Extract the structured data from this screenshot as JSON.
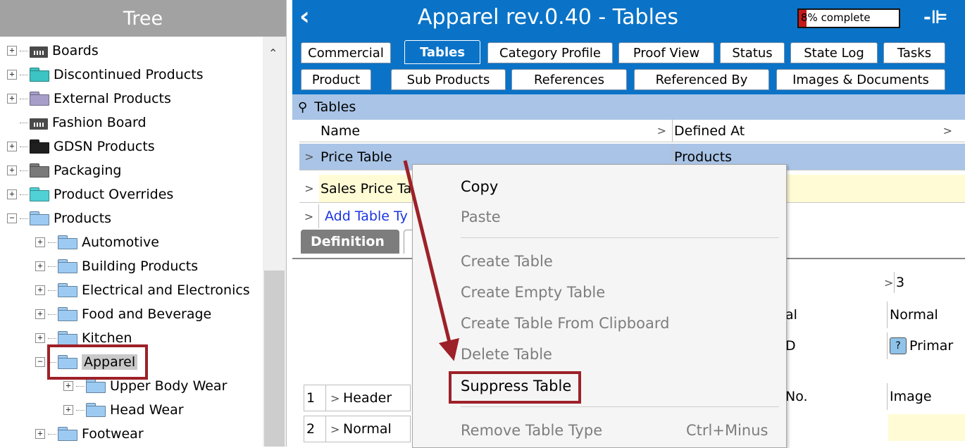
{
  "tree": {
    "title": "Tree",
    "items": [
      {
        "label": "Boards",
        "icon": "board-icon",
        "expander": "+"
      },
      {
        "label": "Discontinued Products",
        "icon": "folder-icon",
        "color": "#3cc3c3",
        "expander": "+"
      },
      {
        "label": "External Products",
        "icon": "folder-icon",
        "color": "#a79fc9",
        "expander": "+"
      },
      {
        "label": "Fashion Board",
        "icon": "board-icon",
        "expander": ""
      },
      {
        "label": "GDSN Products",
        "icon": "folder-icon",
        "color": "#1f1f1f",
        "expander": "+"
      },
      {
        "label": "Packaging",
        "icon": "folder-icon",
        "color": "#7a7a7a",
        "expander": "+"
      },
      {
        "label": "Product Overrides",
        "icon": "folder-icon",
        "color": "#4fd1d6",
        "expander": "+"
      },
      {
        "label": "Products",
        "icon": "folder-icon",
        "color": "#9ccaf2",
        "expander": "−"
      },
      {
        "label": "Automotive",
        "icon": "folder-icon",
        "color": "#9ccaf2",
        "expander": "+"
      },
      {
        "label": "Building Products",
        "icon": "folder-icon",
        "color": "#9ccaf2",
        "expander": "+"
      },
      {
        "label": "Electrical and Electronics",
        "icon": "folder-icon",
        "color": "#9ccaf2",
        "expander": "+"
      },
      {
        "label": "Food and Beverage",
        "icon": "folder-icon",
        "color": "#9ccaf2",
        "expander": "+"
      },
      {
        "label": "Kitchen",
        "icon": "folder-icon",
        "color": "#9ccaf2",
        "expander": "+"
      },
      {
        "label": "Apparel",
        "icon": "folder-icon",
        "color": "#9ccaf2",
        "expander": "−"
      },
      {
        "label": "Upper Body Wear",
        "icon": "folder-icon",
        "color": "#9ccaf2",
        "expander": "+"
      },
      {
        "label": "Head Wear",
        "icon": "folder-icon",
        "color": "#9ccaf2",
        "expander": "+"
      },
      {
        "label": "Footwear",
        "icon": "folder-icon",
        "color": "#9ccaf2",
        "expander": "+"
      }
    ]
  },
  "window": {
    "back_icon": "chevron-left-icon",
    "title": "Apparel rev.0.40 - Tables",
    "progress_text": "8% complete",
    "progress_fraction": 0.08,
    "pin_icon": "pin-icon"
  },
  "tabs": {
    "row1": [
      "Commercial",
      "Tables",
      "Category Profile",
      "Proof View",
      "Status",
      "State Log",
      "Tasks"
    ],
    "row2": [
      "Product",
      "Sub Products",
      "References",
      "Referenced By",
      "Images & Documents"
    ],
    "active": "Tables"
  },
  "tables_section": {
    "title": "Tables",
    "columns": [
      "Name",
      "Defined At"
    ],
    "rows": [
      {
        "name": "Price Table",
        "defined_at": "Products"
      },
      {
        "name": "Sales Price Ta",
        "defined_at": ""
      }
    ],
    "add_link": "Add Table Ty"
  },
  "subtab": {
    "label": "Definition"
  },
  "lower": {
    "col3_header": "3",
    "col3_row1": "Normal",
    "col3_row2": "Primar",
    "col2_row1": "al",
    "col2_row2": "D",
    "col2_row4": "No.",
    "col3_row4": "Image",
    "rows": [
      {
        "num": "1",
        "label": "Header"
      },
      {
        "num": "2",
        "label": "Normal"
      }
    ]
  },
  "context_menu": {
    "items": [
      {
        "label": "Copy",
        "enabled": true
      },
      {
        "label": "Paste",
        "enabled": false
      },
      {
        "label": "Create Table",
        "enabled": false
      },
      {
        "label": "Create Empty Table",
        "enabled": false
      },
      {
        "label": "Create Table From Clipboard",
        "enabled": false
      },
      {
        "label": "Delete Table",
        "enabled": false
      },
      {
        "label": "Suppress Table",
        "enabled": true
      },
      {
        "label": "Remove Table Type",
        "enabled": false,
        "shortcut": "Ctrl+Minus"
      }
    ]
  },
  "annotation": {
    "color": "#9d2129"
  }
}
